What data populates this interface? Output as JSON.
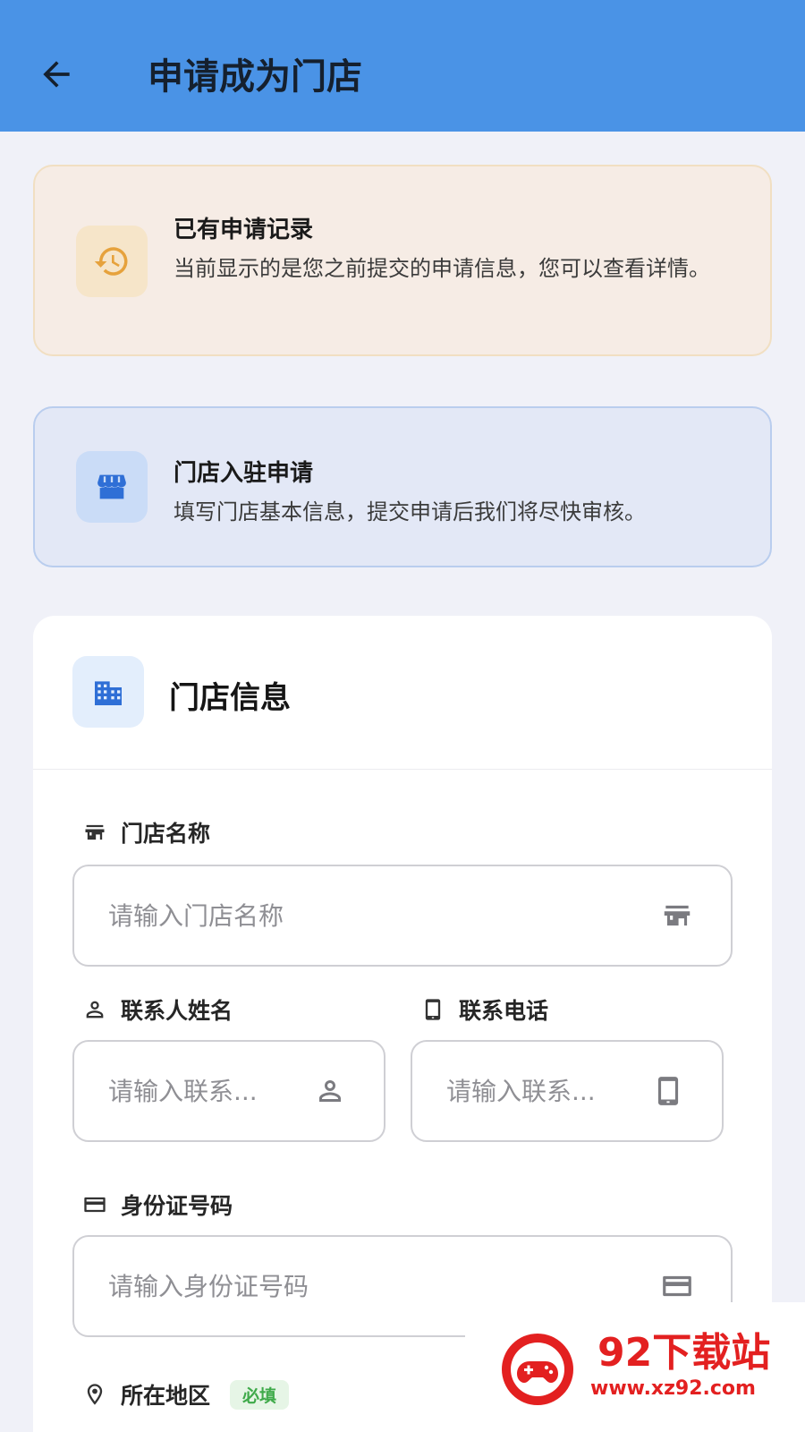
{
  "appbar": {
    "title": "申请成为门店",
    "back_icon": "arrow-left-icon"
  },
  "history_notice": {
    "icon": "history-clock-icon",
    "title": "已有申请记录",
    "text": "当前显示的是您之前提交的申请信息，您可以查看详情。"
  },
  "store_notice": {
    "icon": "storefront-icon",
    "title": "门店入驻申请",
    "text": "填写门店基本信息，提交申请后我们将尽快审核。"
  },
  "store_info": {
    "icon": "building-icon",
    "title": "门店信息",
    "fields": {
      "store_name": {
        "label": "门店名称",
        "placeholder": "请输入门店名称",
        "icon": "store-icon"
      },
      "contact_name": {
        "label": "联系人姓名",
        "placeholder": "请输入联系...",
        "icon": "person-icon"
      },
      "contact_phone": {
        "label": "联系电话",
        "placeholder": "请输入联系...",
        "icon": "phone-icon"
      },
      "id_number": {
        "label": "身份证号码",
        "placeholder": "请输入身份证号码",
        "icon": "id-card-icon"
      },
      "region": {
        "label": "所在地区",
        "required_badge": "必填",
        "icon": "location-pin-icon"
      }
    }
  },
  "watermark": {
    "text": "92下载站",
    "url": "www.xz92.com"
  },
  "colors": {
    "appbar": "#4a93e6",
    "history_bg": "#f6ece5",
    "store_bg": "#e3e8f6",
    "accent_blue": "#2f6fd6",
    "accent_orange": "#e6a23c",
    "required_green": "#3faa4a"
  }
}
